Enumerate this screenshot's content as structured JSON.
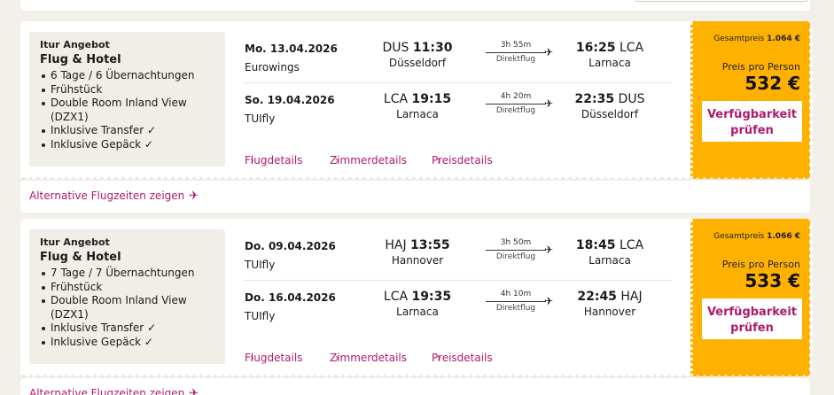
{
  "offers": [
    {
      "kicker": "Itur Angebot",
      "title": "Flug & Hotel",
      "features": [
        "6 Tage / 6 Übernachtungen",
        "Frühstück",
        "Double Room Inland View (DZX1)",
        "Inklusive Transfer ✓",
        "Inklusive Gepäck ✓"
      ],
      "outbound": {
        "date": "Mo. 13.04.2026",
        "airline": "Eurowings",
        "dep_code": "DUS",
        "dep_time": "11:30",
        "dep_city": "Düsseldorf",
        "duration": "3h 55m",
        "type": "Direktflug",
        "arr_time": "16:25",
        "arr_code": "LCA",
        "arr_city": "Larnaca"
      },
      "inbound": {
        "date": "So. 19.04.2026",
        "airline": "TUIfly",
        "dep_code": "LCA",
        "dep_time": "19:15",
        "dep_city": "Larnaca",
        "duration": "4h 20m",
        "type": "Direktflug",
        "arr_time": "22:35",
        "arr_code": "DUS",
        "arr_city": "Düsseldorf"
      },
      "links": {
        "flight": "Flugdetails",
        "room": "Zimmerdetails",
        "price": "Preisdetails"
      },
      "total_label": "Gesamtpreis",
      "total_value": "1.064 €",
      "pp_label": "Preis pro Person",
      "pp_value": "532 €",
      "cta": "Verfügbarkeit prüfen",
      "alt_label": "Alternative Flugzeiten zeigen"
    },
    {
      "kicker": "Itur Angebot",
      "title": "Flug & Hotel",
      "features": [
        "7 Tage / 7 Übernachtungen",
        "Frühstück",
        "Double Room Inland View (DZX1)",
        "Inklusive Transfer ✓",
        "Inklusive Gepäck ✓"
      ],
      "outbound": {
        "date": "Do. 09.04.2026",
        "airline": "TUIfly",
        "dep_code": "HAJ",
        "dep_time": "13:55",
        "dep_city": "Hannover",
        "duration": "3h 50m",
        "type": "Direktflug",
        "arr_time": "18:45",
        "arr_code": "LCA",
        "arr_city": "Larnaca"
      },
      "inbound": {
        "date": "Do. 16.04.2026",
        "airline": "TUIfly",
        "dep_code": "LCA",
        "dep_time": "19:35",
        "dep_city": "Larnaca",
        "duration": "4h 10m",
        "type": "Direktflug",
        "arr_time": "22:45",
        "arr_code": "HAJ",
        "arr_city": "Hannover"
      },
      "links": {
        "flight": "Flugdetails",
        "room": "Zimmerdetails",
        "price": "Preisdetails"
      },
      "total_label": "Gesamtpreis",
      "total_value": "1.066 €",
      "pp_label": "Preis pro Person",
      "pp_value": "533 €",
      "cta": "Verfügbarkeit prüfen",
      "alt_label": "Alternative Flugzeiten zeigen"
    }
  ],
  "icons": {
    "alt_plane": "airplane-icon",
    "leg_arrow": "plane-arrow-icon",
    "link_chevron": "chevron-right-icon"
  },
  "colors": {
    "accent": "#b0196d",
    "price_panel": "#ffb100",
    "info_bg": "#f1ede7",
    "page_bg": "#f3efea"
  }
}
